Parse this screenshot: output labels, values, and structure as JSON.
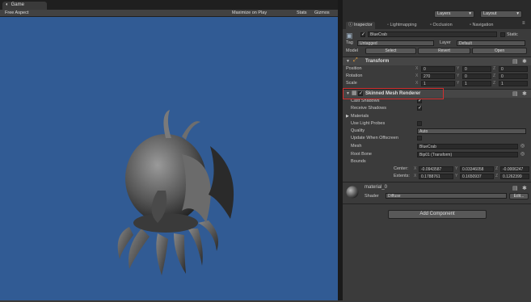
{
  "game": {
    "tab_label": "Game",
    "aspect": "Free Aspect",
    "maximize": "Maximize on Play",
    "stats": "Stats",
    "gizmos": "Gizmos"
  },
  "toolbar": {
    "layers": "Layers",
    "layout": "Layout"
  },
  "tabs": {
    "inspector": "Inspector",
    "lightmapping": "Lightmapping",
    "occlusion": "Occlusion",
    "navigation": "Navigation"
  },
  "object": {
    "name": "BlueCrab",
    "static": "Static",
    "tag_label": "Tag",
    "tag": "Untagged",
    "layer_label": "Layer",
    "layer": "Default",
    "model_label": "Model",
    "select": "Select",
    "revert": "Revert",
    "open": "Open"
  },
  "transform": {
    "title": "Transform",
    "position_label": "Position",
    "position": [
      "0",
      "0",
      "0"
    ],
    "rotation_label": "Rotation",
    "rotation": [
      "270",
      "0",
      "0"
    ],
    "scale_label": "Scale",
    "scale": [
      "1",
      "1",
      "1"
    ]
  },
  "renderer": {
    "title": "Skinned Mesh Renderer",
    "cast_shadows": "Cast Shadows",
    "receive_shadows": "Receive Shadows",
    "materials": "Materials",
    "use_light_probes": "Use Light Probes",
    "quality_label": "Quality",
    "quality": "Auto",
    "update_offscreen": "Update When Offscreen",
    "mesh_label": "Mesh",
    "mesh": "BlueCrab",
    "root_bone_label": "Root Bone",
    "root_bone": "Bip01 (Transform)",
    "bounds": "Bounds",
    "center_label": "Center:",
    "center": [
      "-0.0943587",
      "0.03346058",
      "-0.0006247"
    ],
    "extents_label": "Extents:",
    "extents": [
      "0.1788761",
      "0.1650937",
      "0.1262399"
    ]
  },
  "material": {
    "name": "material_0",
    "shader_label": "Shader",
    "shader": "Diffuse",
    "edit": "Edit..."
  },
  "add_component": "Add Component",
  "axes": [
    "X",
    "Y",
    "Z"
  ]
}
